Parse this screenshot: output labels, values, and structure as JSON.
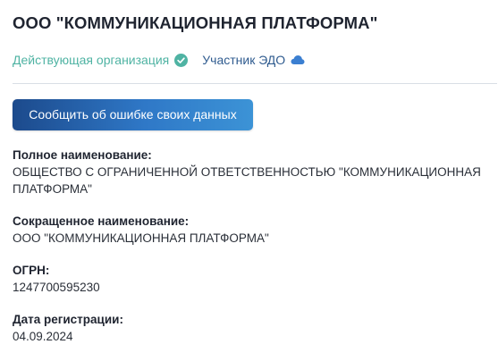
{
  "company": {
    "title": "ООО \"КОММУНИКАЦИОННАЯ ПЛАТФОРМА\""
  },
  "status": {
    "active_label": "Действующая организация",
    "active_icon": "check-circle-icon",
    "edo_label": "Участник ЭДО",
    "edo_icon": "cloud-icon",
    "colors": {
      "active": "#4fb3a3",
      "edo": "#2f5b8f"
    }
  },
  "actions": {
    "report_error_label": "Сообщить об ошибке своих данных"
  },
  "details": {
    "full_name_label": "Полное наименование:",
    "full_name_line1": "ОБЩЕСТВО С ОГРАНИЧЕННОЙ ОТВЕТСТВЕННОСТЬЮ \"КОММУНИКАЦИОННАЯ",
    "full_name_line2": "ПЛАТФОРМА\"",
    "short_name_label": "Сокращенное наименование:",
    "short_name_value": "ООО \"КОММУНИКАЦИОННАЯ ПЛАТФОРМА\"",
    "ogrn_label": "ОГРН:",
    "ogrn_value": "1247700595230",
    "reg_date_label": "Дата регистрации:",
    "reg_date_value": "04.09.2024"
  }
}
